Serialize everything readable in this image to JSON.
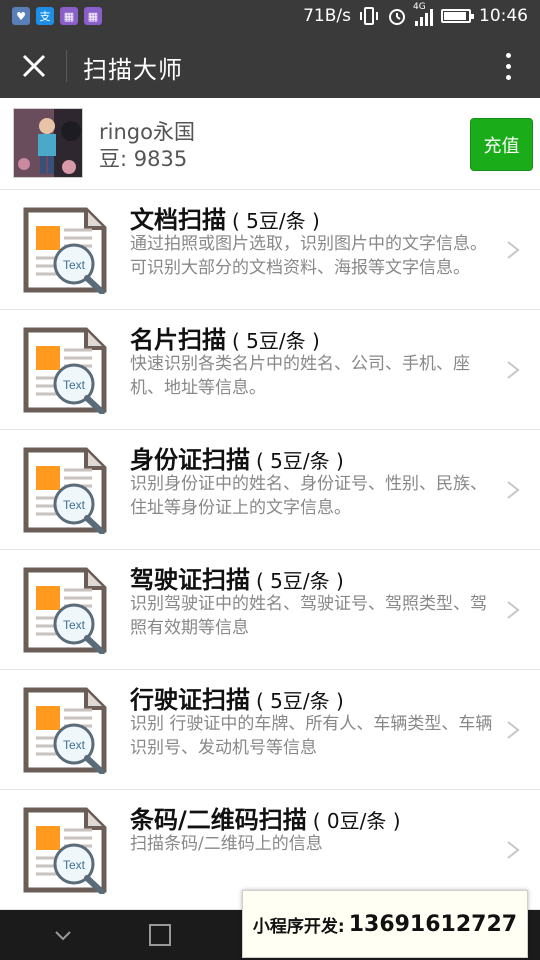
{
  "status_bar": {
    "net_speed": "71B/s",
    "signal_tag": "4G",
    "time": "10:46",
    "battery_level": 0.9,
    "notifications": [
      "heart-icon",
      "alipay-icon",
      "gallery-icon",
      "gallery-icon"
    ]
  },
  "title_bar": {
    "title": "扫描大师"
  },
  "user": {
    "name": "ringo永国",
    "beans": "豆: 9835",
    "recharge_label": "充值"
  },
  "icon_text": "Text",
  "scan_items": [
    {
      "title": "文档扫描",
      "price": "( 5豆/条 )",
      "desc": "通过拍照或图片选取，识别图片中的文字信息。可识别大部分的文档资料、海报等文字信息。"
    },
    {
      "title": "名片扫描",
      "price": "( 5豆/条 )",
      "desc": "快速识别各类名片中的姓名、公司、手机、座机、地址等信息。"
    },
    {
      "title": "身份证扫描",
      "price": "( 5豆/条 )",
      "desc": "识别身份证中的姓名、身份证号、性别、民族、住址等身份证上的文字信息。"
    },
    {
      "title": "驾驶证扫描",
      "price": "( 5豆/条 )",
      "desc": "识别驾驶证中的姓名、驾驶证号、驾照类型、驾照有效期等信息"
    },
    {
      "title": "行驶证扫描",
      "price": "( 5豆/条 )",
      "desc": "识别 行驶证中的车牌、所有人、车辆类型、车辆识别号、发动机号等信息"
    },
    {
      "title": "条码/二维码扫描",
      "price": "( 0豆/条 )",
      "desc": "扫描条码/二维码上的信息"
    }
  ],
  "overlay": {
    "label": "小程序开发:",
    "phone": "13691612727"
  },
  "colors": {
    "top_bar": "#3a3a3a",
    "accent_green": "#1aad19",
    "doc_orange": "#ff9a1f",
    "doc_frame": "#6b5e57"
  }
}
